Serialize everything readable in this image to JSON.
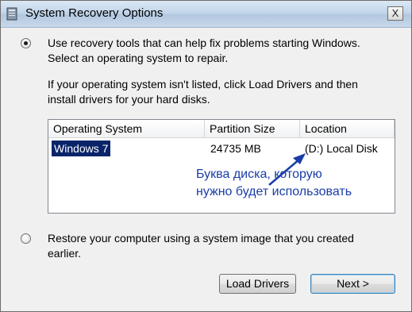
{
  "window": {
    "title": "System Recovery Options",
    "close_label": "X"
  },
  "option_repair": {
    "selected": true,
    "line1": "Use recovery tools that can help fix problems starting Windows.",
    "line2": "Select an operating system to repair."
  },
  "info": {
    "line1": "If your operating system isn't listed, click Load Drivers and then",
    "line2": "install drivers for your hard disks."
  },
  "os_table": {
    "columns": [
      "Operating System",
      "Partition Size",
      "Location"
    ],
    "rows": [
      {
        "os": "Windows 7",
        "size": "24735 MB",
        "location": "(D:) Local Disk",
        "selected": true
      }
    ]
  },
  "annotation": {
    "line1": "Буква диска, которую",
    "line2": "нужно будет использовать",
    "color": "#1a3da8"
  },
  "option_restore": {
    "selected": false,
    "line1": "Restore your computer using a system image that you created",
    "line2": "earlier."
  },
  "buttons": {
    "load_drivers": "Load Drivers",
    "next": "Next >"
  }
}
